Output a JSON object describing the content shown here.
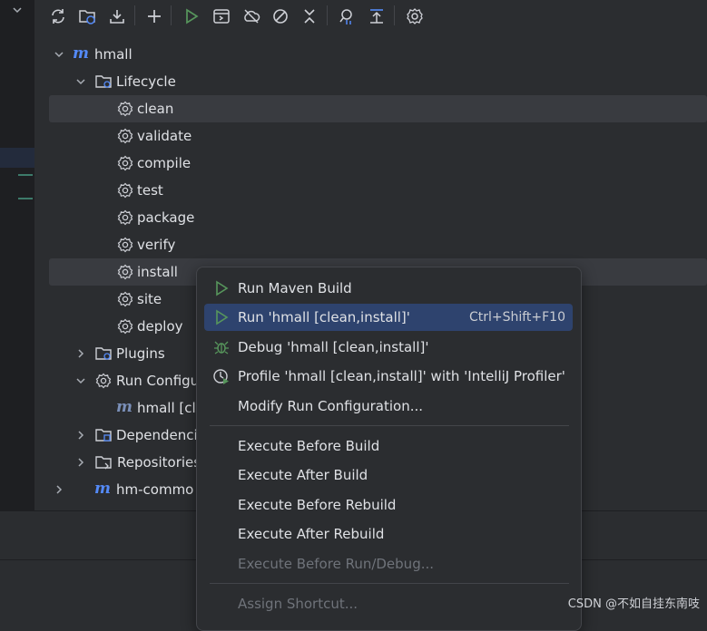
{
  "tree": {
    "project": "hmall",
    "lifecycle": "Lifecycle",
    "phases": [
      "clean",
      "validate",
      "compile",
      "test",
      "package",
      "verify",
      "install",
      "site",
      "deploy"
    ],
    "plugins": "Plugins",
    "run_configurations": "Run Configu",
    "run_config_item": "hmall [cle",
    "dependencies": "Dependenci",
    "repositories": "Repositories",
    "next_module": "hm-commo"
  },
  "menu": {
    "run_maven_build": "Run Maven Build",
    "run_config": "Run 'hmall [clean,install]'",
    "run_shortcut": "Ctrl+Shift+F10",
    "debug": "Debug 'hmall [clean,install]'",
    "profile": "Profile 'hmall [clean,install]' with 'IntelliJ Profiler'",
    "modify": "Modify Run Configuration...",
    "exec_before_build": "Execute Before Build",
    "exec_after_build": "Execute After Build",
    "exec_before_rebuild": "Execute Before Rebuild",
    "exec_after_rebuild": "Execute After Rebuild",
    "exec_before_run": "Execute Before Run/Debug...",
    "assign_shortcut": "Assign Shortcut..."
  },
  "watermark": "CSDN @不如自挂东南吱",
  "colors": {
    "accent": "#2e436e",
    "run_green": "#57965c",
    "maven_blue": "#548af7"
  }
}
